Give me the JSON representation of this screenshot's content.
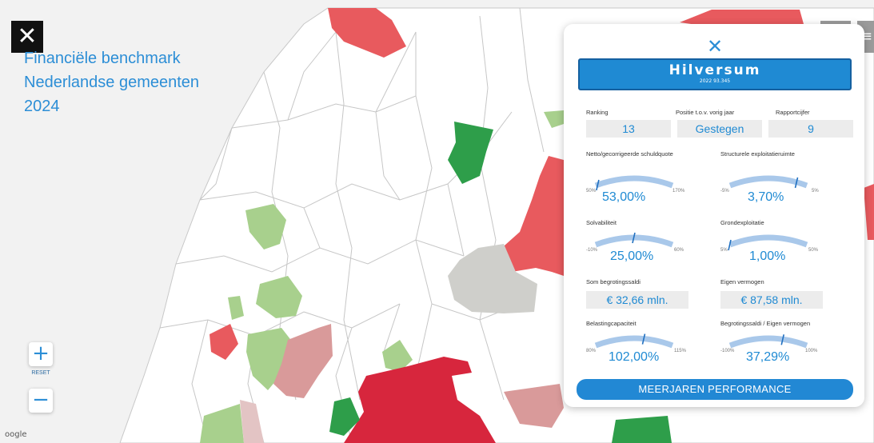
{
  "app": {
    "title_lines": [
      "Financiële benchmark",
      "Nederlandse gemeenten",
      "2024"
    ]
  },
  "map": {
    "zoom_in": "+",
    "zoom_out": "−",
    "reset_label": "RESET",
    "attribution": "oogle",
    "colors": {
      "deep_red": "#d7263d",
      "red": "#e85a5e",
      "light_red": "#d99a9a",
      "dark_green": "#2e9e4a",
      "light_green": "#a8d08d",
      "grey": "#cfcfcb"
    }
  },
  "panel": {
    "close": "✕",
    "city": "Hilversum",
    "city_meta": "2022   93.345",
    "ranking_label": "Ranking",
    "ranking_value": "13",
    "position_label": "Positie t.o.v. vorig jaar",
    "position_value": "Gestegen",
    "rating_label": "Rapportcijfer",
    "rating_value": "9",
    "gauges": [
      {
        "label": "Netto/gecorrigeerde schuldquote",
        "value": "53,00%",
        "min": "50%",
        "max": "170%",
        "fraction": 0.03
      },
      {
        "label": "Structurele exploitatieruimte",
        "value": "3,70%",
        "min": "-5%",
        "max": "5%",
        "fraction": 0.87
      },
      {
        "label": "Solvabiliteit",
        "value": "25,00%",
        "min": "-10%",
        "max": "60%",
        "fraction": 0.5
      },
      {
        "label": "Grondexploitatie",
        "value": "1,00%",
        "min": "5%",
        "max": "50%",
        "fraction": 0.0
      },
      {
        "label": "Belastingcapaciteit",
        "value": "102,00%",
        "min": "80%",
        "max": "115%",
        "fraction": 0.63
      },
      {
        "label": "Begrotingssaldi / Eigen vermogen",
        "value": "37,29%",
        "min": "-100%",
        "max": "100%",
        "fraction": 0.69
      }
    ],
    "som_label": "Som begrotingssaldi",
    "som_value": "€ 32,66 mln.",
    "eigen_label": "Eigen vermogen",
    "eigen_value": "€ 87,58 mln.",
    "cta": "MEERJAREN PERFORMANCE"
  },
  "topbar": {
    "home_icon": "⌂",
    "menu_icon": "≡"
  }
}
